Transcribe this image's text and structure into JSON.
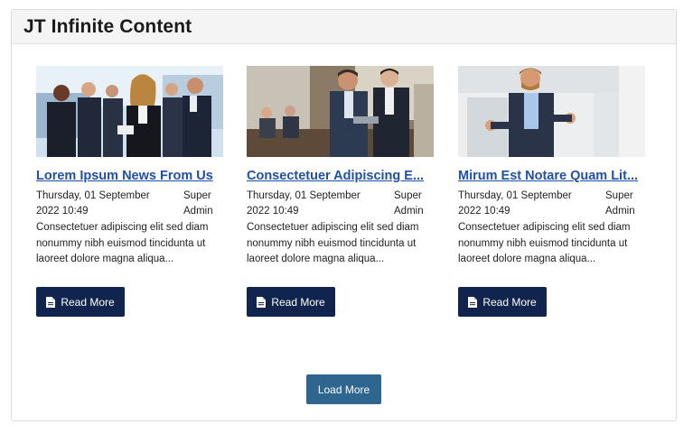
{
  "module": {
    "title": "JT Infinite Content"
  },
  "articles": [
    {
      "title": "Lorem Ipsum News From Us",
      "date": "Thursday, 01 September 2022 10:49",
      "author": "Super Admin",
      "excerpt": "Consectetuer adipiscing elit sed diam nonummy nibh euismod tincidunta ut laoreet dolore magna aliqua...",
      "read_more": "Read More",
      "image_icon": "business-team-photo"
    },
    {
      "title": "Consectetuer Adipiscing E...",
      "date": "Thursday, 01 September 2022 10:49",
      "author": "Super Admin",
      "excerpt": "Consectetuer adipiscing elit sed diam nonummy nibh euismod tincidunta ut laoreet dolore magna aliqua...",
      "read_more": "Read More",
      "image_icon": "meeting-photo"
    },
    {
      "title": "Mirum Est Notare Quam Lit...",
      "date": "Thursday, 01 September 2022 10:49",
      "author": "Super Admin",
      "excerpt": "Consectetuer adipiscing elit sed diam nonummy nibh euismod tincidunta ut laoreet dolore magna aliqua...",
      "read_more": "Read More",
      "image_icon": "businessman-photo"
    }
  ],
  "load_more": "Load More",
  "colors": {
    "title_link": "#1f4fa8",
    "read_more_bg": "#11244d",
    "load_more_bg": "#2f6690"
  }
}
